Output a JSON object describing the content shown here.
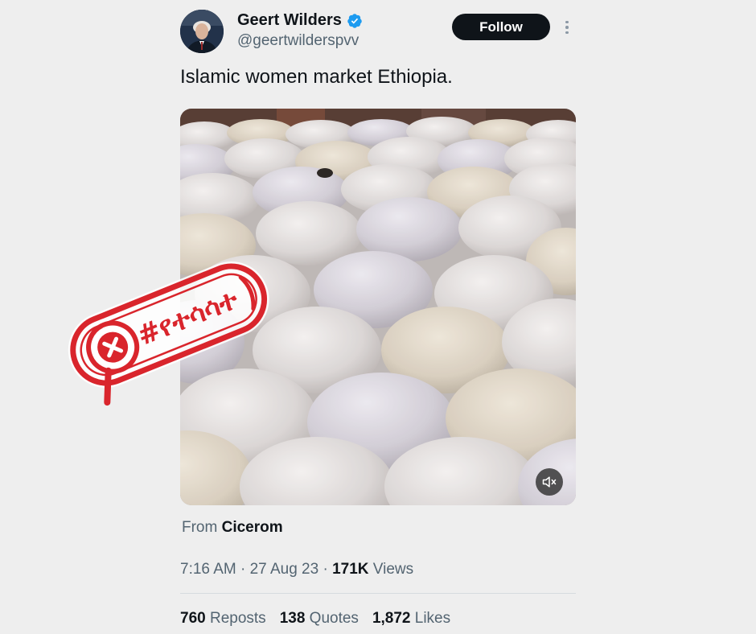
{
  "author": {
    "name": "Geert Wilders",
    "handle": "@geertwilderspvv",
    "verified": true
  },
  "actions": {
    "follow_label": "Follow",
    "more_icon": "more-vertical-icon"
  },
  "tweet": {
    "text": "Islamic women market Ethiopia."
  },
  "media": {
    "type": "video",
    "mute_icon": "volume-muted-icon"
  },
  "source": {
    "prefix": "From",
    "name": "Cicerom"
  },
  "meta": {
    "time": "7:16 AM",
    "date": "27 Aug 23",
    "views_count": "171K",
    "views_label": "Views"
  },
  "stats": {
    "reposts_count": "760",
    "reposts_label": "Reposts",
    "quotes_count": "138",
    "quotes_label": "Quotes",
    "likes_count": "1,872",
    "likes_label": "Likes"
  },
  "stamp": {
    "text": "#የተሳሳተ",
    "color": "#d9252c"
  },
  "colors": {
    "verified_blue": "#1d9bf0",
    "follow_bg": "#0f1419",
    "secondary_text": "#536471"
  }
}
